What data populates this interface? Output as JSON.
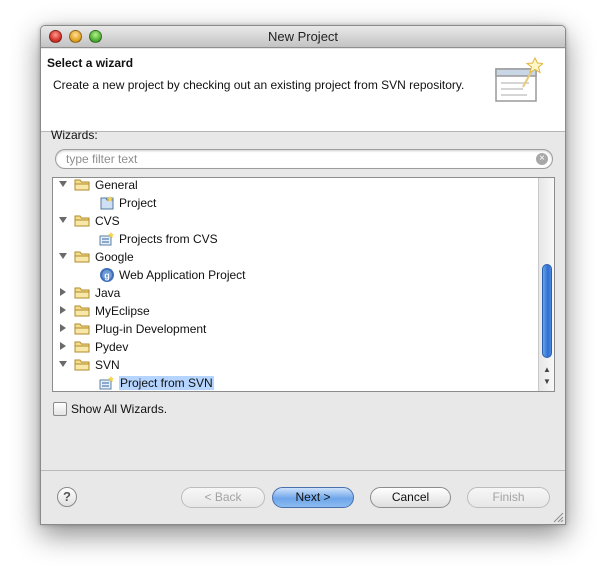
{
  "window": {
    "title": "New Project"
  },
  "banner": {
    "title": "Select a wizard",
    "description": "Create a new project by checking out an existing project from SVN repository."
  },
  "wizards": {
    "label": "Wizards:",
    "filter": {
      "placeholder": "type filter text",
      "value": ""
    }
  },
  "tree": {
    "items": [
      {
        "label": "General",
        "type": "folder",
        "expanded": true,
        "icon": "folder-icon"
      },
      {
        "label": "Project",
        "type": "item",
        "icon": "project-icon"
      },
      {
        "label": "CVS",
        "type": "folder",
        "expanded": true,
        "icon": "folder-icon"
      },
      {
        "label": "Projects from CVS",
        "type": "item",
        "icon": "cvs-checkout-icon"
      },
      {
        "label": "Google",
        "type": "folder",
        "expanded": true,
        "icon": "folder-icon"
      },
      {
        "label": "Web Application Project",
        "type": "item",
        "icon": "google-web-app-icon"
      },
      {
        "label": "Java",
        "type": "folder",
        "expanded": false,
        "icon": "folder-icon"
      },
      {
        "label": "MyEclipse",
        "type": "folder",
        "expanded": false,
        "icon": "folder-icon"
      },
      {
        "label": "Plug-in Development",
        "type": "folder",
        "expanded": false,
        "icon": "folder-icon"
      },
      {
        "label": "Pydev",
        "type": "folder",
        "expanded": false,
        "icon": "folder-icon"
      },
      {
        "label": "SVN",
        "type": "folder",
        "expanded": true,
        "icon": "folder-icon"
      },
      {
        "label": "Project from SVN",
        "type": "item",
        "icon": "svn-checkout-icon",
        "selected": true
      }
    ]
  },
  "show_all": {
    "label": "Show All Wizards.",
    "checked": false
  },
  "buttons": {
    "help": "?",
    "back": "< Back",
    "next": "Next >",
    "cancel": "Cancel",
    "finish": "Finish"
  },
  "colors": {
    "selection": "#b5d5ff",
    "default_button": "#6ea6ea",
    "scroll_thumb": "#2d6fd4"
  }
}
